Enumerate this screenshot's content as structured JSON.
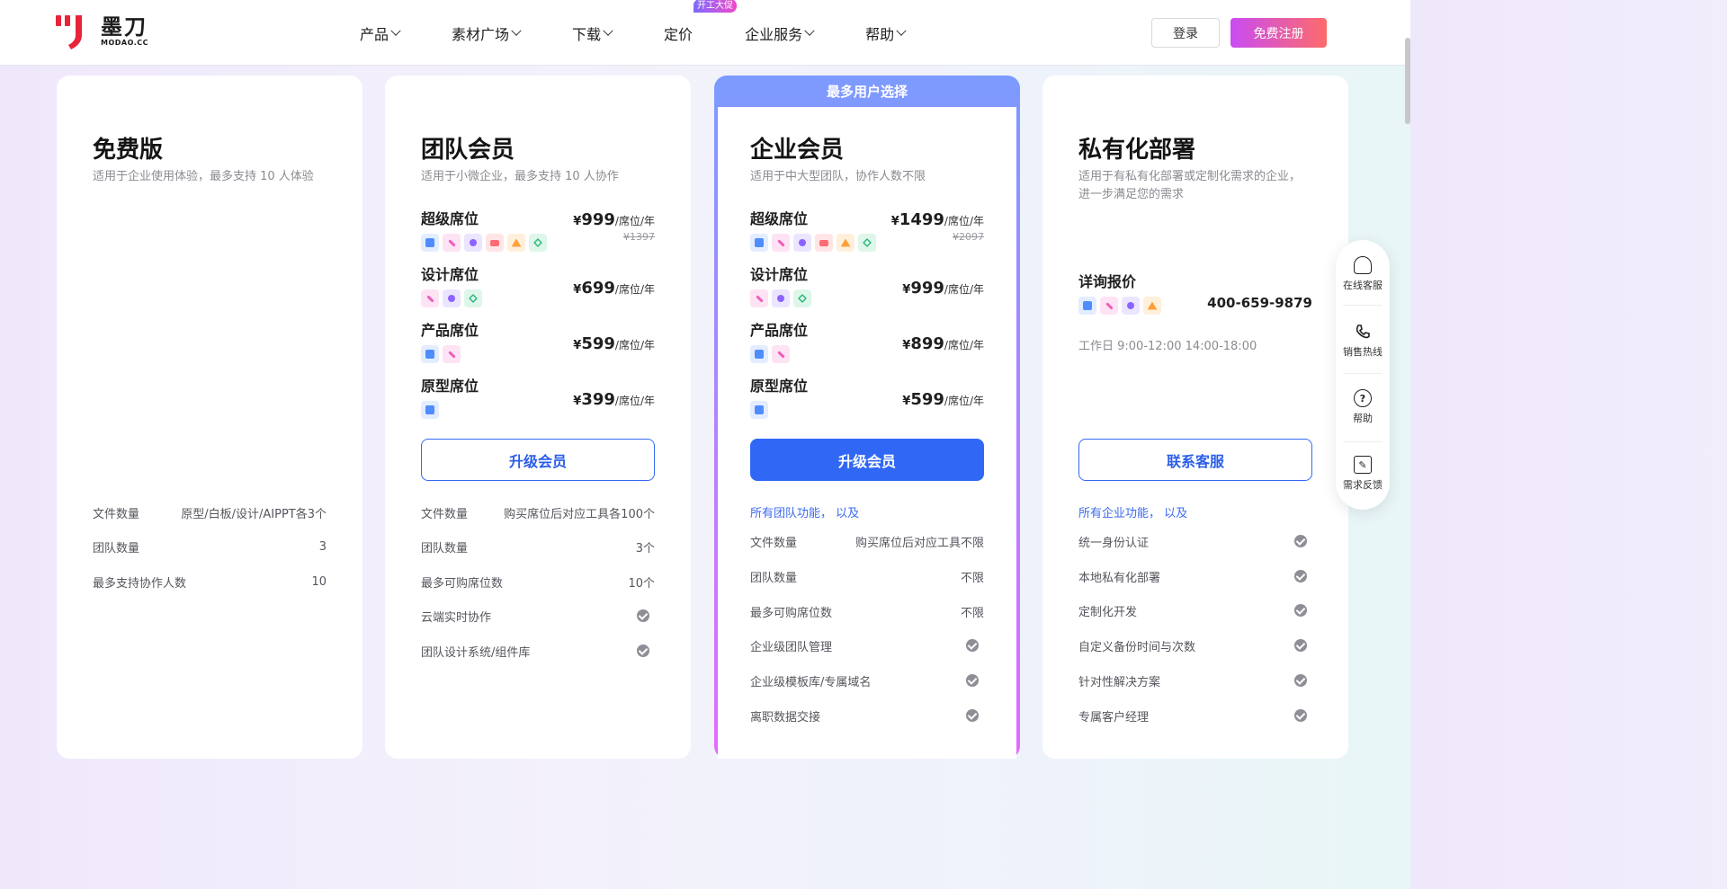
{
  "header": {
    "logo_name": "墨刀",
    "logo_sub": "MODAO.CC",
    "nav": [
      {
        "label": "产品",
        "dropdown": true
      },
      {
        "label": "素材广场",
        "dropdown": true
      },
      {
        "label": "下载",
        "dropdown": true
      },
      {
        "label": "定价",
        "dropdown": false,
        "badge": "开工大促"
      },
      {
        "label": "企业服务",
        "dropdown": true
      },
      {
        "label": "帮助",
        "dropdown": true
      }
    ],
    "login": "登录",
    "register": "免费注册"
  },
  "colors": {
    "accent": "#3068f5",
    "brand_red": "#e8233a",
    "register_gradient": [
      "#c94cf3",
      "#fd6b6b"
    ]
  },
  "plans": {
    "free": {
      "title": "免费版",
      "desc": "适用于企业使用体验，最多支持 10 人体验",
      "features": [
        {
          "name": "文件数量",
          "value": "原型/白板/设计/AIPPT各3个"
        },
        {
          "name": "团队数量",
          "value": "3"
        },
        {
          "name": "最多支持协作人数",
          "value": "10"
        }
      ]
    },
    "team": {
      "title": "团队会员",
      "desc": "适用于小微企业，最多支持 10 人协作",
      "seats": [
        {
          "name": "超级席位",
          "price": "999",
          "unit": "/席位/年",
          "orig": "¥1397",
          "icons": [
            "prototype-icon",
            "whiteboard-icon",
            "design-icon",
            "aippt-icon",
            "flowchart-icon",
            "code-icon"
          ]
        },
        {
          "name": "设计席位",
          "price": "699",
          "unit": "/席位/年",
          "icons": [
            "whiteboard-icon",
            "design-icon",
            "code-icon"
          ]
        },
        {
          "name": "产品席位",
          "price": "599",
          "unit": "/席位/年",
          "icons": [
            "prototype-icon",
            "whiteboard-icon"
          ]
        },
        {
          "name": "原型席位",
          "price": "399",
          "unit": "/席位/年",
          "icons": [
            "prototype-icon"
          ]
        }
      ],
      "button": "升级会员",
      "features": [
        {
          "name": "文件数量",
          "value": "购买席位后对应工具各100个"
        },
        {
          "name": "团队数量",
          "value": "3个"
        },
        {
          "name": "最多可购席位数",
          "value": "10个"
        },
        {
          "name": "云端实时协作",
          "value": "check"
        },
        {
          "name": "团队设计系统/组件库",
          "value": "check"
        }
      ]
    },
    "enterprise": {
      "banner": "最多用户选择",
      "title": "企业会员",
      "desc": "适用于中大型团队，协作人数不限",
      "seats": [
        {
          "name": "超级席位",
          "price": "1499",
          "unit": "/席位/年",
          "orig": "¥2097",
          "icons": [
            "prototype-icon",
            "whiteboard-icon",
            "design-icon",
            "aippt-icon",
            "flowchart-icon",
            "code-icon"
          ]
        },
        {
          "name": "设计席位",
          "price": "999",
          "unit": "/席位/年",
          "icons": [
            "whiteboard-icon",
            "design-icon",
            "code-icon"
          ]
        },
        {
          "name": "产品席位",
          "price": "899",
          "unit": "/席位/年",
          "icons": [
            "prototype-icon",
            "whiteboard-icon"
          ]
        },
        {
          "name": "原型席位",
          "price": "599",
          "unit": "/席位/年",
          "icons": [
            "prototype-icon"
          ]
        }
      ],
      "button": "升级会员",
      "features_head": "所有团队功能， 以及",
      "features": [
        {
          "name": "文件数量",
          "value": "购买席位后对应工具不限"
        },
        {
          "name": "团队数量",
          "value": "不限"
        },
        {
          "name": "最多可购席位数",
          "value": "不限"
        },
        {
          "name": "企业级团队管理",
          "value": "check"
        },
        {
          "name": "企业级模板库/专属域名",
          "value": "check"
        },
        {
          "name": "离职数据交接",
          "value": "check"
        }
      ]
    },
    "private": {
      "title": "私有化部署",
      "desc": "适用于有私有化部署或定制化需求的企业，进一步满足您的需求",
      "consult": "详询报价",
      "phone": "400-659-9879",
      "hours": "工作日 9:00-12:00 14:00-18:00",
      "button": "联系客服",
      "features_head": "所有企业功能， 以及",
      "features": [
        {
          "name": "统一身份认证",
          "value": "check"
        },
        {
          "name": "本地私有化部署",
          "value": "check"
        },
        {
          "name": "定制化开发",
          "value": "check"
        },
        {
          "name": "自定义备份时间与次数",
          "value": "check"
        },
        {
          "name": "针对性解决方案",
          "value": "check"
        },
        {
          "name": "专属客户经理",
          "value": "check"
        }
      ]
    }
  },
  "currency": "¥",
  "side": [
    {
      "label": "在线客服",
      "icon": "headset-icon"
    },
    {
      "label": "销售热线",
      "icon": "phone-icon"
    },
    {
      "label": "帮助",
      "icon": "help-icon"
    },
    {
      "label": "需求反馈",
      "icon": "feedback-icon"
    }
  ]
}
